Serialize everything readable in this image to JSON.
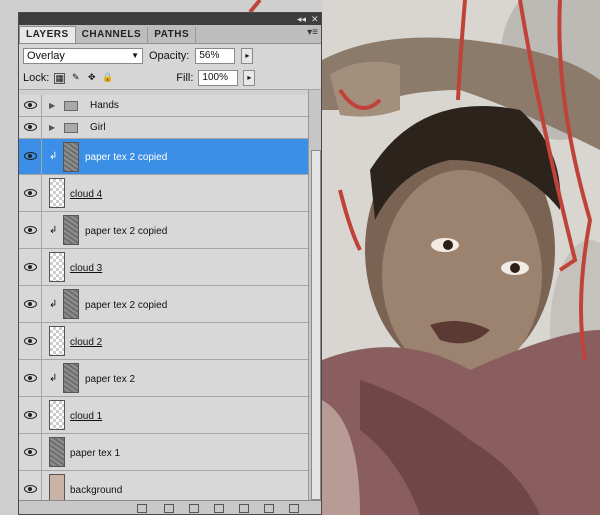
{
  "panel": {
    "tabs": [
      "LAYERS",
      "CHANNELS",
      "PATHS"
    ],
    "blend_mode": "Overlay",
    "opacity_label": "Opacity:",
    "opacity_value": "56%",
    "lock_label": "Lock:",
    "fill_label": "Fill:",
    "fill_value": "100%"
  },
  "layers": [
    {
      "name": "Hands",
      "kind": "group"
    },
    {
      "name": "Girl",
      "kind": "group"
    },
    {
      "name": "paper tex 2 copied",
      "kind": "texture",
      "clipped": true,
      "selected": true
    },
    {
      "name": "cloud 4",
      "kind": "cloud"
    },
    {
      "name": "paper tex 2 copied",
      "kind": "texture",
      "clipped": true
    },
    {
      "name": "cloud 3",
      "kind": "cloud"
    },
    {
      "name": "paper tex 2 copied",
      "kind": "texture",
      "clipped": true
    },
    {
      "name": "cloud 2",
      "kind": "cloud"
    },
    {
      "name": "paper tex 2",
      "kind": "texture",
      "clipped": true
    },
    {
      "name": "cloud 1",
      "kind": "cloud"
    },
    {
      "name": "paper tex 1",
      "kind": "texture"
    },
    {
      "name": "background",
      "kind": "background"
    }
  ],
  "colors": {
    "selection": "#3c8fe6",
    "string": "#c0433a"
  }
}
